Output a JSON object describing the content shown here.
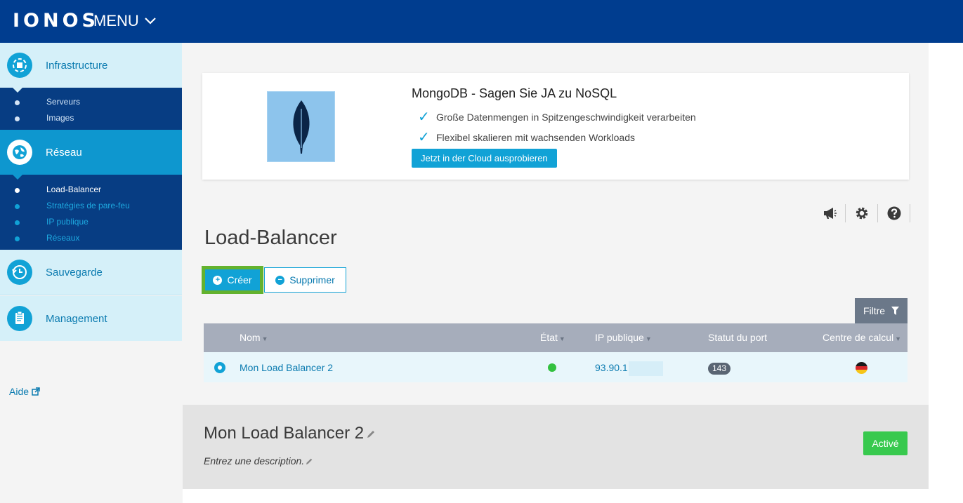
{
  "header": {
    "logo": "IONOS",
    "menu_label": "MENU"
  },
  "sidebar": {
    "sections": [
      {
        "label": "Infrastructure",
        "icon": "infrastructure-icon"
      },
      {
        "label": "Réseau",
        "icon": "globe-icon"
      },
      {
        "label": "Sauvegarde",
        "icon": "backup-clock-icon"
      },
      {
        "label": "Management",
        "icon": "clipboard-icon"
      }
    ],
    "infrastructure_items": [
      "Serveurs",
      "Images"
    ],
    "reseau_items": [
      "Load-Balancer",
      "Stratégies de pare-feu",
      "IP publique",
      "Réseaux"
    ],
    "help_label": "Aide"
  },
  "promo": {
    "title": "MongoDB - Sagen Sie JA zu NoSQL",
    "bullets": [
      "Große Datenmengen in Spitzengeschwindigkeit verarbeiten",
      "Flexibel skalieren mit wachsenden Workloads"
    ],
    "button_label": "Jetzt in der Cloud ausprobieren"
  },
  "toolbar_icons": [
    "megaphone-icon",
    "gear-icon",
    "help-icon"
  ],
  "page": {
    "title": "Load-Balancer",
    "create_label": "Créer",
    "delete_label": "Supprimer",
    "filter_label": "Filtre"
  },
  "table": {
    "headers": [
      "Nom",
      "État",
      "IP publique",
      "Statut du port",
      "Centre de calcul"
    ],
    "rows": [
      {
        "name": "Mon Load Balancer 2",
        "status": "active",
        "ip": "93.90.1",
        "port": "143",
        "datacenter": "de-flag"
      }
    ]
  },
  "detail": {
    "title": "Mon Load Balancer 2",
    "description_placeholder": "Entrez une description.",
    "status_label": "Activé"
  },
  "colors": {
    "header_bg": "#003d8f",
    "accent": "#11a2d6",
    "highlight_green": "#63b22e",
    "active_green": "#38c94e"
  }
}
